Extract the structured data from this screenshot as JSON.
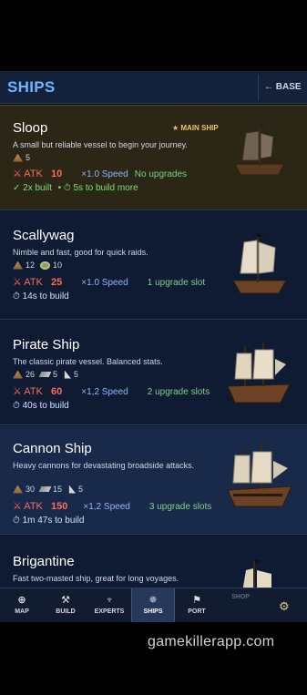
{
  "header": {
    "title": "SHIPS",
    "back_label": "← BASE"
  },
  "ships": [
    {
      "name": "Sloop",
      "badge": "★ MAIN SHIP",
      "description": "A small but reliable vessel to begin your journey.",
      "cost": [
        {
          "icon": "wood-icon",
          "amount": "5"
        }
      ],
      "atk_label": "⚔ ATK",
      "atk": "10",
      "speed": "×1.0 Speed",
      "upgrades": "No upgrades",
      "build": "✓ 2x built",
      "build_extra": "• ⏱ 5s to build more"
    },
    {
      "name": "Scallywag",
      "description": "Nimble and fast, good for quick raids.",
      "cost": [
        {
          "icon": "wood-icon",
          "amount": "12"
        },
        {
          "icon": "rope-icon",
          "amount": "10"
        }
      ],
      "atk_label": "⚔ ATK",
      "atk": "25",
      "speed": "×1.0 Speed",
      "upgrades": "1 upgrade slot",
      "build": "⏱ 14s to build"
    },
    {
      "name": "Pirate Ship",
      "description": "The classic pirate vessel. Balanced stats.",
      "cost": [
        {
          "icon": "wood-icon",
          "amount": "26"
        },
        {
          "icon": "plank-icon",
          "amount": "5"
        },
        {
          "icon": "sail-icon",
          "amount": "5"
        }
      ],
      "atk_label": "⚔ ATK",
      "atk": "60",
      "speed": "×1,2 Speed",
      "upgrades": "2 upgrade slots",
      "build": "⏱ 40s to build"
    },
    {
      "name": "Cannon Ship",
      "description": "Heavy cannons for devastating broadside attacks.",
      "cost": [
        {
          "icon": "wood-icon",
          "amount": "30"
        },
        {
          "icon": "plank-icon",
          "amount": "15"
        },
        {
          "icon": "sail-icon",
          "amount": "5"
        }
      ],
      "atk_label": "⚔ ATK",
      "atk": "150",
      "speed": "×1,2 Speed",
      "upgrades": "3 upgrade slots",
      "build": "⏱ 1m 47s to build"
    },
    {
      "name": "Brigantine",
      "description": "Fast two-masted ship, great for long voyages."
    }
  ],
  "nav": [
    {
      "label": "MAP",
      "glyph": "⊕",
      "icon": "map-icon"
    },
    {
      "label": "BUILD",
      "glyph": "⚒",
      "icon": "build-icon"
    },
    {
      "label": "EXPERTS",
      "glyph": "♆",
      "icon": "experts-icon"
    },
    {
      "label": "SHIPS",
      "glyph": "✵",
      "icon": "ships-icon"
    },
    {
      "label": "PORT",
      "glyph": "⚑",
      "icon": "port-icon"
    },
    {
      "label": "SHOP",
      "glyph": "",
      "icon": "shop-icon"
    }
  ],
  "settings_glyph": "⚙",
  "watermark": "gamekillerapp.com"
}
